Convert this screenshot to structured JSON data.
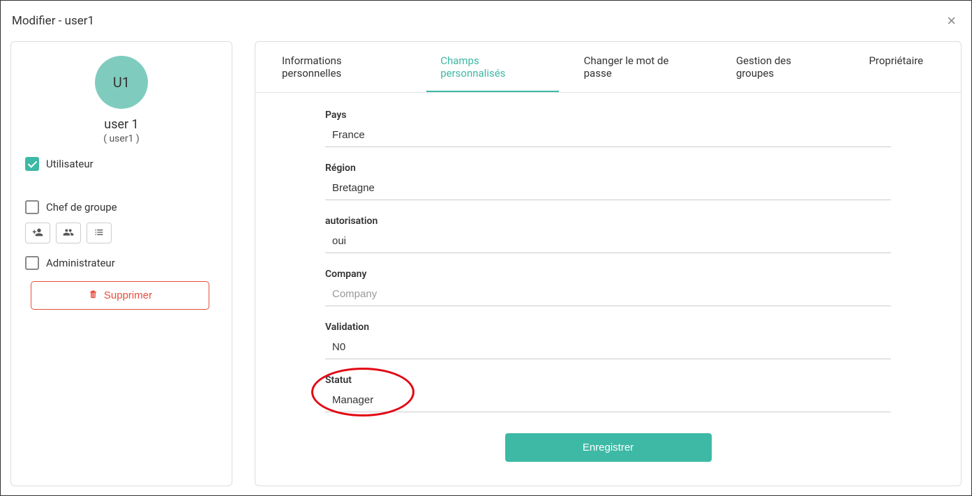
{
  "modal": {
    "title": "Modifier - user1"
  },
  "sidebar": {
    "avatar_initials": "U1",
    "display_name": "user 1",
    "login": "( user1 )",
    "roles": {
      "utilisateur": {
        "label": "Utilisateur",
        "checked": true
      },
      "chef_groupe": {
        "label": "Chef de groupe",
        "checked": false
      },
      "administrateur": {
        "label": "Administrateur",
        "checked": false
      }
    },
    "delete_label": "Supprimer"
  },
  "tabs": [
    {
      "id": "info",
      "label": "Informations personnelles",
      "active": false
    },
    {
      "id": "custom",
      "label": "Champs personnalisés",
      "active": true
    },
    {
      "id": "pwd",
      "label": "Changer le mot de passe",
      "active": false
    },
    {
      "id": "groups",
      "label": "Gestion des groupes",
      "active": false
    },
    {
      "id": "owner",
      "label": "Propriétaire",
      "active": false
    }
  ],
  "fields": {
    "pays": {
      "label": "Pays",
      "value": "France"
    },
    "region": {
      "label": "Région",
      "value": "Bretagne"
    },
    "autorisation": {
      "label": "autorisation",
      "value": "oui"
    },
    "company": {
      "label": "Company",
      "value": "",
      "placeholder": "Company"
    },
    "validation": {
      "label": "Validation",
      "value": "N0"
    },
    "statut": {
      "label": "Statut",
      "value": "Manager",
      "highlighted": true
    }
  },
  "actions": {
    "save_label": "Enregistrer"
  }
}
